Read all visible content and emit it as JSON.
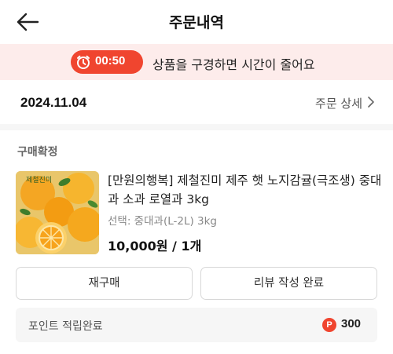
{
  "header": {
    "title": "주문내역",
    "back_icon": "arrow-left-icon"
  },
  "banner": {
    "timer": "00:50",
    "timer_icon": "stopwatch-icon",
    "message": "상품을 구경하면 시간이 줄어요",
    "accent_color": "#f0452f",
    "background_color": "#fdeceb"
  },
  "order": {
    "date": "2024.11.04",
    "detail_link": "주문 상세",
    "detail_icon": "chevron-right-icon",
    "status": "구매확정"
  },
  "product": {
    "image_text": "제철진미",
    "name": "[만원의행복] 제철진미 제주 햇 노지감귤(극조생) 중대과 소과 로열과 3kg",
    "option": "선택: 중대과(L-2L) 3kg",
    "price": "10,000원 / 1개"
  },
  "actions": {
    "rebuy": "재구매",
    "review": "리뷰 작성 완료"
  },
  "points": {
    "label": "포인트 적립완료",
    "badge": "P",
    "value": "300"
  }
}
